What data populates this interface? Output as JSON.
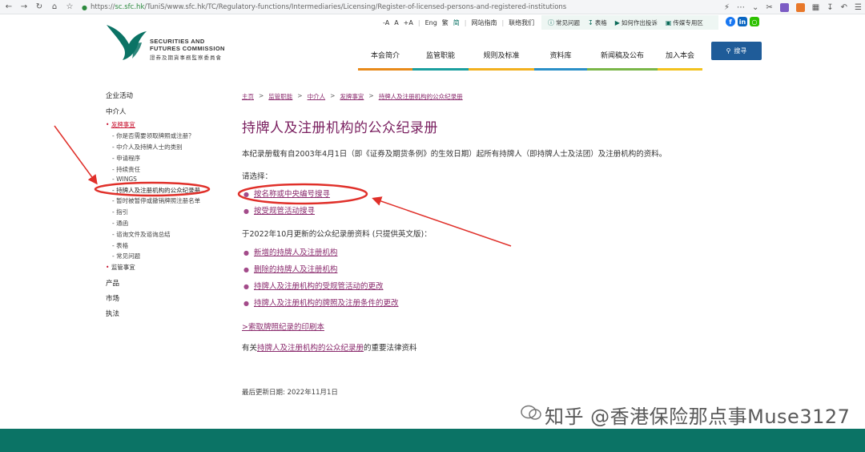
{
  "browser": {
    "url_scheme": "https://",
    "url_host": "sc.sfc.hk",
    "url_path": "/TuniS/www.sfc.hk/TC/Regulatory-functions/Intermediaries/Licensing/Register-of-licensed-persons-and-registered-institutions"
  },
  "logo": {
    "line1": "SECURITIES AND",
    "line2": "FUTURES COMMISSION",
    "line3": "證券及期貨事務監察委員會"
  },
  "header": {
    "font_controls": [
      "-A",
      "A",
      "+A"
    ],
    "languages": [
      "Eng",
      "繁",
      "简"
    ],
    "sitemap": "网站指南",
    "contact": "联络我们",
    "util_links": [
      {
        "icon": "question-icon",
        "label": "常见问题"
      },
      {
        "icon": "download-icon",
        "label": "表格"
      },
      {
        "icon": "megaphone-icon",
        "label": "如何作出投诉"
      },
      {
        "icon": "media-icon",
        "label": "传媒专用区"
      }
    ],
    "search_label": "搜寻"
  },
  "mainnav": [
    {
      "label": "本会简介",
      "color": "#e88a1a"
    },
    {
      "label": "监管职能",
      "color": "#1a9f9f"
    },
    {
      "label": "规则及标准",
      "color": "#f2b01e"
    },
    {
      "label": "资料库",
      "color": "#2a8fc7"
    },
    {
      "label": "新闻稿及公布",
      "color": "#7ab648"
    },
    {
      "label": "加入本会",
      "color": "#f2c21e"
    }
  ],
  "sidebar": {
    "top": "企业活动",
    "section": "中介人",
    "licensing": "发牌事宜",
    "items": [
      "你是否需要领取牌照或注册？",
      "中介人及持牌人士的类别",
      "申请程序",
      "持续责任",
      "WINGS",
      "持牌人及注册机构的公众纪录册",
      "暂时被暂停或撤销牌照注册名单",
      "指引",
      "通函",
      "谘询文件及谘询总结",
      "表格",
      "常见问题"
    ],
    "supervision": "监管事宜",
    "others": [
      "产品",
      "市场",
      "执法"
    ]
  },
  "breadcrumb": [
    "主页",
    "监管职能",
    "中介人",
    "发牌事宜",
    "持牌人及注册机构的公众纪录册"
  ],
  "content": {
    "title": "持牌人及注册机构的公众纪录册",
    "intro": "本纪录册载有自2003年4月1日（即《证券及期货条例》的生效日期）起所有持牌人（即持牌人士及法团）及注册机构的资料。",
    "choose": "请选择：",
    "options": [
      "按名称或中央编号搜寻",
      "按受规管活动搜寻"
    ],
    "update_heading": "于2022年10月更新的公众纪录册资料 (只提供英文版)：",
    "updates": [
      "新增的持牌人及注册机构",
      "删除的持牌人及注册机构",
      "持牌人及注册机构的受规管活动的更改",
      "持牌人及注册机构的牌照及注册条件的更改"
    ],
    "print_link": ">索取牌照纪录的印刷本",
    "legal_prefix": "有关",
    "legal_link": "持牌人及注册机构的公众纪录册",
    "legal_suffix": "的重要法律资料",
    "updated": "最后更新日期: 2022年11月1日"
  },
  "watermark": "知乎 @香港保险那点事Muse3127",
  "colors": {
    "accent": "#7a2060",
    "link": "#8a2a6d",
    "footer": "#0b7365",
    "annotation": "#e0302a",
    "search": "#1f5c99"
  }
}
